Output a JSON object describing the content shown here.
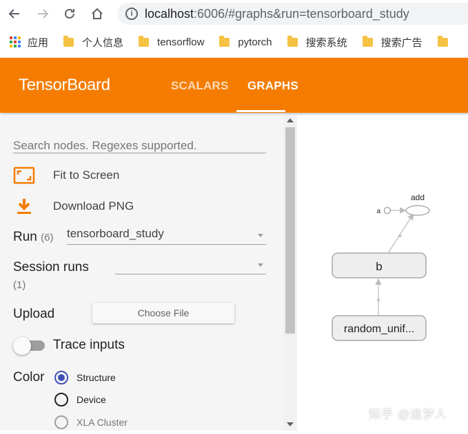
{
  "browser": {
    "url_host": "localhost",
    "url_rest": ":6006/#graphs&run=tensorboard_study",
    "bookmarks": [
      {
        "label": "应用",
        "icon": "apps-icon"
      },
      {
        "label": "个人信息",
        "icon": "folder-icon"
      },
      {
        "label": "tensorflow",
        "icon": "folder-icon"
      },
      {
        "label": "pytorch",
        "icon": "folder-icon"
      },
      {
        "label": "搜索系统",
        "icon": "folder-icon"
      },
      {
        "label": "搜索广告",
        "icon": "folder-icon"
      }
    ]
  },
  "header": {
    "brand": "TensorBoard",
    "tabs": [
      {
        "label": "SCALARS",
        "active": false
      },
      {
        "label": "GRAPHS",
        "active": true
      }
    ],
    "color": "#f57c00"
  },
  "sidebar": {
    "search_placeholder": "Search nodes. Regexes supported.",
    "fit_label": "Fit to Screen",
    "download_label": "Download PNG",
    "run_label": "Run",
    "run_count": "(6)",
    "run_value": "tensorboard_study",
    "session_label": "Session runs",
    "session_count": "(1)",
    "session_value": "",
    "upload_label": "Upload",
    "choose_file": "Choose File",
    "trace_label": "Trace inputs",
    "color_label": "Color",
    "color_options": [
      {
        "label": "Structure",
        "selected": true
      },
      {
        "label": "Device",
        "selected": false
      },
      {
        "label": "XLA Cluster",
        "selected": false
      }
    ]
  },
  "graph": {
    "nodes": {
      "add": "add",
      "a": "a",
      "b": "b",
      "random": "random_unif..."
    }
  },
  "watermark": "知乎 @追梦人"
}
